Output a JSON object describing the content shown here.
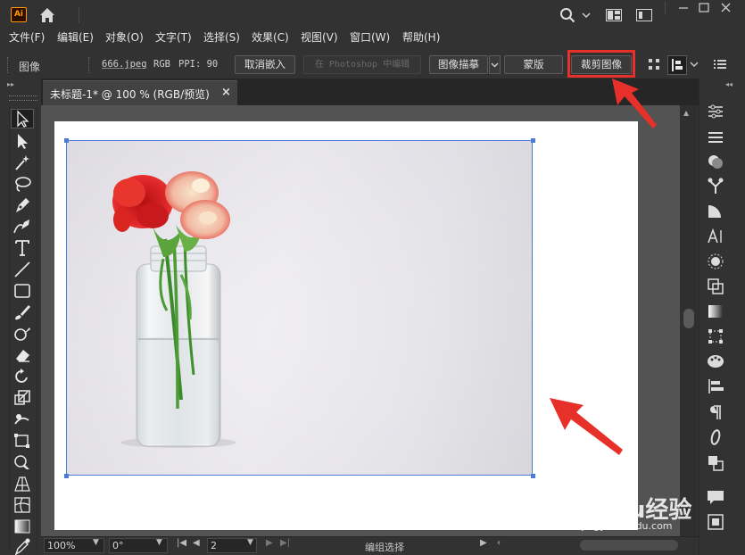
{
  "app": {
    "logo_text": "Ai",
    "accent_color": "#ff9a00"
  },
  "menu": [
    {
      "label": "文件(F)"
    },
    {
      "label": "编辑(E)"
    },
    {
      "label": "对象(O)"
    },
    {
      "label": "文字(T)"
    },
    {
      "label": "选择(S)"
    },
    {
      "label": "效果(C)"
    },
    {
      "label": "视图(V)"
    },
    {
      "label": "窗口(W)"
    },
    {
      "label": "帮助(H)"
    }
  ],
  "control_bar": {
    "object_type": "图像",
    "filename": "666.jpeg",
    "color_mode": "RGB",
    "ppi": "PPI: 90",
    "unembed_button": "取消嵌入",
    "edit_in_photoshop_button": "在 Photoshop 中编辑",
    "image_trace_button": "图像描摹",
    "mask_button": "蒙版",
    "crop_image_button": "裁剪图像",
    "highlight_color": "#e8302a"
  },
  "document": {
    "tab_title": "未标题-1* @ 100 % (RGB/预览)",
    "close_symbol": "×",
    "selection_color": "#4b7bd9"
  },
  "status_bar": {
    "zoom": "100%",
    "rotation": "0°",
    "artboard_number": "2",
    "status": "编组选择"
  },
  "watermark": {
    "brand": "Baidu经验",
    "url": "jingyan.baidu.com"
  },
  "icons": {
    "title_bar": [
      "home-icon",
      "search-icon",
      "workspace-layout-icon",
      "panel-toggle-icon"
    ],
    "tools": [
      "selection-tool-icon",
      "direct-selection-tool-icon",
      "magic-wand-tool-icon",
      "lasso-tool-icon",
      "pen-tool-icon",
      "curvature-tool-icon",
      "type-tool-icon",
      "line-tool-icon",
      "rectangle-tool-icon",
      "paintbrush-tool-icon",
      "shaper-tool-icon",
      "eraser-tool-icon",
      "rotate-tool-icon",
      "scale-tool-icon",
      "warp-tool-icon",
      "free-transform-tool-icon",
      "shape-builder-tool-icon",
      "perspective-grid-tool-icon",
      "mesh-tool-icon",
      "gradient-tool-icon",
      "eyedropper-tool-icon"
    ],
    "right_panels": [
      "properties-panel-icon",
      "layers-panel-icon",
      "appearance-panel-icon",
      "symbols-panel-icon",
      "color-guide-panel-icon",
      "character-panel-icon",
      "stroke-panel-icon",
      "pathfinder-panel-icon",
      "gradient-panel-icon",
      "transform-panel-icon",
      "swatches-panel-icon",
      "align-panel-icon",
      "paragraph-panel-icon",
      "opentype-panel-icon",
      "links-panel-icon",
      "comments-panel-icon",
      "artboards-panel-icon"
    ]
  }
}
